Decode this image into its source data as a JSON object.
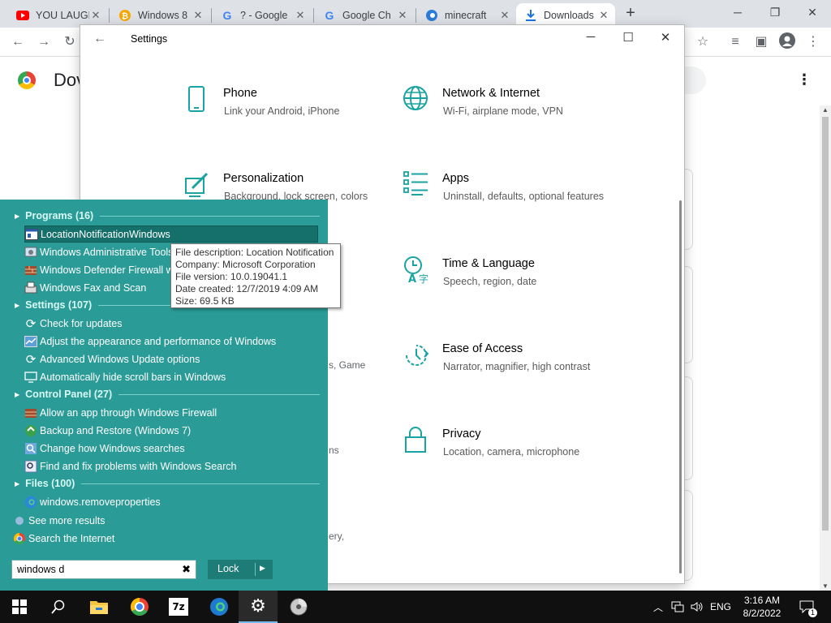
{
  "browser": {
    "tabs": [
      {
        "title": "YOU LAUGH",
        "icon": "youtube-icon",
        "active": false
      },
      {
        "title": "Windows 8",
        "icon": "bitcoin-icon",
        "active": false
      },
      {
        "title": "? - Google",
        "icon": "google-icon",
        "active": false
      },
      {
        "title": "Google Ch",
        "icon": "google-icon",
        "active": false
      },
      {
        "title": "minecraft",
        "icon": "edge-icon",
        "active": false
      },
      {
        "title": "Downloads",
        "icon": "download-icon",
        "active": true
      }
    ],
    "page_title": "Dov",
    "behind_fragments": [
      "s, Game",
      "ns",
      "ery,"
    ]
  },
  "settings": {
    "title": "Settings",
    "categories": [
      {
        "name": "Phone",
        "desc": "Link your Android, iPhone",
        "icon": "phone-icon"
      },
      {
        "name": "Network & Internet",
        "desc": "Wi-Fi, airplane mode, VPN",
        "icon": "globe-icon"
      },
      {
        "name": "Personalization",
        "desc": "Background, lock screen, colors",
        "icon": "paintbrush-icon"
      },
      {
        "name": "Apps",
        "desc": "Uninstall, defaults, optional features",
        "icon": "apps-list-icon"
      },
      {
        "name": "Time & Language",
        "desc": "Speech, region, date",
        "icon": "time-language-icon"
      },
      {
        "name": "Ease of Access",
        "desc": "Narrator, magnifier, high contrast",
        "icon": "ease-of-access-icon"
      },
      {
        "name": "Privacy",
        "desc": "Location, camera, microphone",
        "icon": "lock-icon"
      }
    ]
  },
  "start_menu": {
    "groups": [
      {
        "label": "Programs (16)",
        "items": [
          {
            "label": "LocationNotificationWindows",
            "icon": "window-app-icon",
            "selected": true
          },
          {
            "label": "Windows Administrative Tools",
            "icon": "admin-tools-icon"
          },
          {
            "label": "Windows Defender Firewall with Advanced Security",
            "icon": "firewall-icon"
          },
          {
            "label": "Windows Fax and Scan",
            "icon": "fax-icon"
          }
        ]
      },
      {
        "label": "Settings (107)",
        "items": [
          {
            "label": "Check for updates",
            "icon": "refresh-icon"
          },
          {
            "label": "Adjust the appearance and performance of Windows",
            "icon": "performance-icon"
          },
          {
            "label": "Advanced Windows Update options",
            "icon": "refresh-icon"
          },
          {
            "label": "Automatically hide scroll bars in Windows",
            "icon": "monitor-icon"
          }
        ]
      },
      {
        "label": "Control Panel (27)",
        "items": [
          {
            "label": "Allow an app through Windows Firewall",
            "icon": "firewall-icon"
          },
          {
            "label": "Backup and Restore (Windows 7)",
            "icon": "backup-icon"
          },
          {
            "label": "Change how Windows searches",
            "icon": "search-options-icon"
          },
          {
            "label": "Find and fix problems with Windows Search",
            "icon": "troubleshoot-icon"
          }
        ]
      },
      {
        "label": "Files (100)",
        "items": [
          {
            "label": "windows.removeproperties",
            "icon": "edge-icon"
          }
        ]
      }
    ],
    "see_more": "See more results",
    "search_internet": "Search the Internet",
    "search_value": "windows d",
    "lock_label": "Lock"
  },
  "tooltip": {
    "lines": [
      "File description: Location Notification",
      "Company: Microsoft Corporation",
      "File version: 10.0.19041.1",
      "Date created: 12/7/2019 4:09 AM",
      "Size: 69.5 KB"
    ]
  },
  "taskbar": {
    "apps": [
      "start-icon",
      "search-icon",
      "file-explorer-icon",
      "chrome-icon",
      "7zip-icon",
      "edge-icon",
      "settings-gear-icon",
      "disc-icon"
    ],
    "seven_zip_label": "7z",
    "language": "ENG",
    "time": "3:16 AM",
    "date": "8/2/2022",
    "notification_count": "1"
  },
  "colors": {
    "start_menu_bg": "#2a9b96",
    "settings_accent": "#1aa3a3",
    "chrome_tabstrip": "#dee1e6",
    "taskbar": "#101010"
  }
}
